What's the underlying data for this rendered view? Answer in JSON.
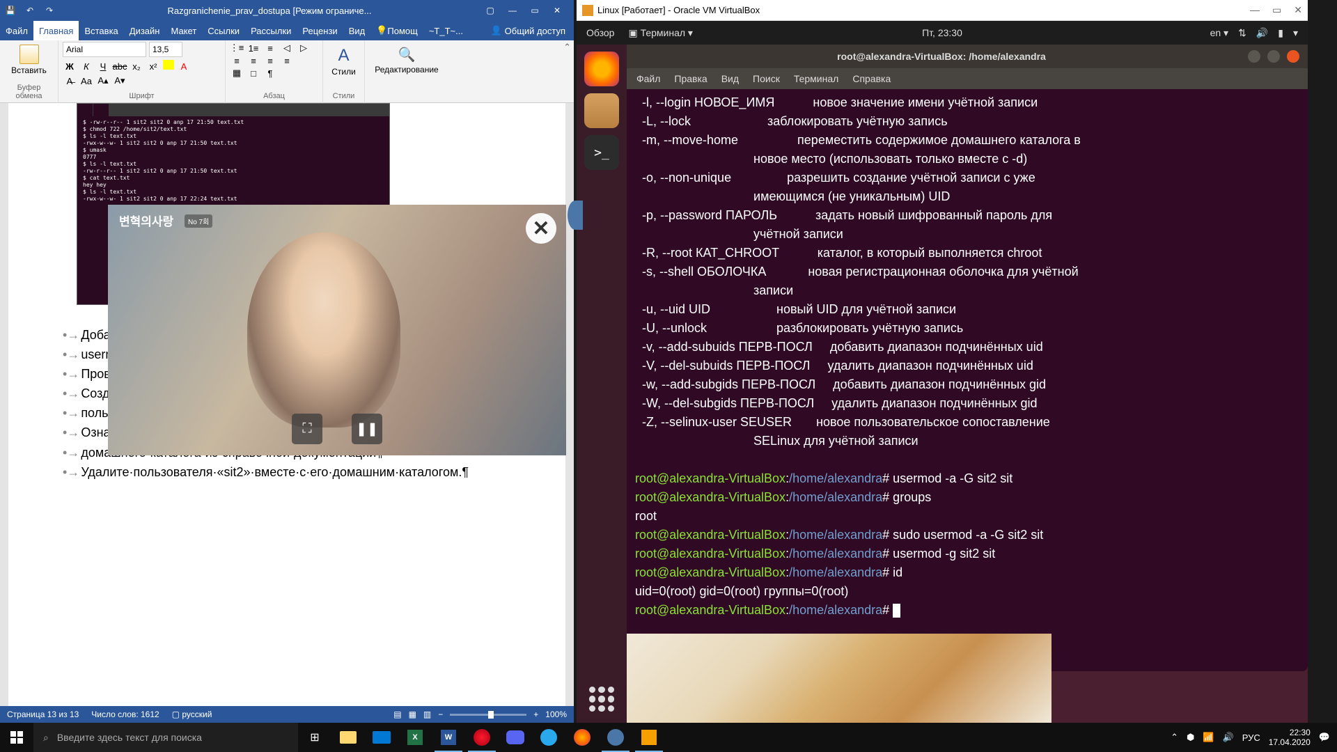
{
  "word": {
    "title": "Razgranichenie_prav_dostupa [Режим ограниче...",
    "qat": {
      "save": "💾",
      "undo": "↶",
      "redo": "↷"
    },
    "window_controls": {
      "box": "▢",
      "min": "—",
      "max": "▭",
      "close": "✕"
    },
    "tabs": [
      "Файл",
      "Главная",
      "Вставка",
      "Дизайн",
      "Макет",
      "Ссылки",
      "Рассылки",
      "Рецензи",
      "Вид"
    ],
    "active_tab": "Главная",
    "help": "Помощ",
    "tt": "~T_T~...",
    "share": "Общий доступ",
    "ribbon": {
      "clipboard": {
        "paste": "Вставить",
        "label": "Буфер обмена"
      },
      "font": {
        "name": "Arial",
        "size": "13,5",
        "label": "Шрифт",
        "bold": "Ж",
        "italic": "К",
        "underline": "Ч",
        "strike": "abc"
      },
      "paragraph": {
        "label": "Абзац"
      },
      "styles": {
        "btn": "Стили",
        "label": "Стили"
      },
      "editing": {
        "btn": "Редактирование"
      }
    },
    "thumb_text": "$ -rw-r--r-- 1 sit2 sit2 0 anp 17 21:50 text.txt\n$ chmod 722 /home/sit2/text.txt\n$ ls -l text.txt\n-rwx-w--w- 1 sit2 sit2 0 anp 17 21:50 text.txt\n$ umask\n0777\n$ ls -l text.txt\n-rw-r--r-- 1 sit2 sit2 0 anp 17 21:50 text.txt\n$ cat text.txt\nhey hey\n$ ls -l text.txt\n-rwx-w--w- 1 sit2 sit2 0 anp 17 22:24 text.txt",
    "doc_lines": [
      "Добави",
      "userm",
      "Прове",
      "Созда",
      "польз",
      "Ознакомьтесь·как·удалить·пользователя·вместе·с·содержимым·ег",
      "домашнего·каталога·из·справочной·документации¶",
      "Удалите·пользователя·«sit2»·вместе·с·его·домашним·каталогом.¶"
    ],
    "video": {
      "logo": "변혁의사랑",
      "ep": "No 7회",
      "close": "✕",
      "pip": "⛶",
      "pause": "❚❚"
    },
    "status": {
      "page": "Страница 13 из 13",
      "words": "Число слов: 1612",
      "lang": "русский",
      "zoom": "100%"
    }
  },
  "vbox": {
    "title": "Linux [Работает] - Oracle VM VirtualBox",
    "window_controls": {
      "min": "—",
      "max": "▭",
      "close": "✕"
    },
    "ubuntu_top": {
      "overview": "Обзор",
      "terminal": "Терминал ▾",
      "clock": "Пт, 23:30",
      "lang": "en ▾"
    },
    "terminal": {
      "title": "root@alexandra-VirtualBox: /home/alexandra",
      "menu": [
        "Файл",
        "Правка",
        "Вид",
        "Поиск",
        "Терминал",
        "Справка"
      ],
      "options": [
        [
          "-l, --login НОВОЕ_ИМЯ",
          "новое значение имени учётной записи"
        ],
        [
          "-L, --lock",
          "заблокировать учётную запись"
        ],
        [
          "-m, --move-home",
          "переместить содержимое домашнего каталога в"
        ],
        [
          "",
          "новое место (использовать только вместе с -d)"
        ],
        [
          "-o, --non-unique",
          "разрешить создание учётной записи с уже"
        ],
        [
          "",
          "имеющимся (не уникальным) UID"
        ],
        [
          "-p, --password ПАРОЛЬ",
          "задать новый шифрованный пароль для"
        ],
        [
          "",
          "учётной записи"
        ],
        [
          "-R, --root КАТ_CHROOT",
          "каталог, в который выполняется chroot"
        ],
        [
          "-s, --shell ОБОЛОЧКА",
          "новая регистрационная оболочка для учётной"
        ],
        [
          "",
          "записи"
        ],
        [
          "-u, --uid UID",
          "новый UID для учётной записи"
        ],
        [
          "-U, --unlock",
          "разблокировать учётную запись"
        ],
        [
          "-v, --add-subuids ПЕРВ-ПОСЛ",
          "добавить диапазон подчинённых uid"
        ],
        [
          "-V, --del-subuids ПЕРВ-ПОСЛ",
          "удалить диапазон подчинённых uid"
        ],
        [
          "-w, --add-subgids ПЕРВ-ПОСЛ",
          "добавить диапазон подчинённых gid"
        ],
        [
          "-W, --del-subgids ПЕРВ-ПОСЛ",
          "удалить диапазон подчинённых gid"
        ],
        [
          "-Z, --selinux-user SEUSER",
          "новое пользовательское сопоставление"
        ],
        [
          "",
          "SELinux для учётной записи"
        ]
      ],
      "session": [
        {
          "prompt": "root@alexandra-VirtualBox",
          "path": "/home/alexandra",
          "cmd": "usermod -a -G sit2 sit"
        },
        {
          "prompt": "root@alexandra-VirtualBox",
          "path": "/home/alexandra",
          "cmd": "groups"
        },
        {
          "out": "root"
        },
        {
          "prompt": "root@alexandra-VirtualBox",
          "path": "/home/alexandra",
          "cmd": "sudo usermod -a -G sit2 sit"
        },
        {
          "prompt": "root@alexandra-VirtualBox",
          "path": "/home/alexandra",
          "cmd": "usermod -g sit2 sit"
        },
        {
          "prompt": "root@alexandra-VirtualBox",
          "path": "/home/alexandra",
          "cmd": "id"
        },
        {
          "out": "uid=0(root) gid=0(root) группы=0(root)"
        },
        {
          "prompt": "root@alexandra-VirtualBox",
          "path": "/home/alexandra",
          "cmd": ""
        }
      ]
    }
  },
  "taskbar": {
    "search_placeholder": "Введите здесь текст для поиска",
    "tray": {
      "lang": "РУС",
      "time": "22:30",
      "date": "17.04.2020"
    }
  }
}
